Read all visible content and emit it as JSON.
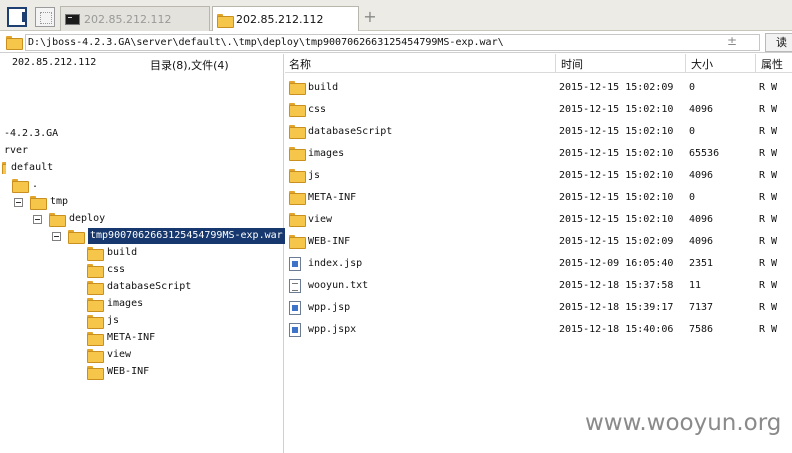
{
  "tabs": {
    "inactive_label": "202.85.212.112",
    "active_label": "202.85.212.112",
    "add_label": "+"
  },
  "pathbar": {
    "path": "D:\\jboss-4.2.3.GA\\server\\default\\.\\tmp\\deploy\\tmp9007062663125454799MS-exp.war\\",
    "spinner": "±",
    "go_label": "读"
  },
  "left": {
    "ip": "202.85.212.112",
    "counts": "目录(8),文件(4)",
    "tree": {
      "jboss": "-4.2.3.GA",
      "server": "rver",
      "default": "default",
      "dot": ".",
      "tmp": "tmp",
      "deploy": "deploy",
      "war": "tmp9007062663125454799MS-exp.war",
      "children": [
        "build",
        "css",
        "databaseScript",
        "images",
        "js",
        "META-INF",
        "view",
        "WEB-INF"
      ]
    }
  },
  "list": {
    "headers": {
      "name": "名称",
      "time": "时间",
      "size": "大小",
      "attr": "属性"
    },
    "rows": [
      {
        "type": "folder",
        "name": "build",
        "time": "2015-12-15 15:02:09",
        "size": "0",
        "attr": "R W"
      },
      {
        "type": "folder",
        "name": "css",
        "time": "2015-12-15 15:02:10",
        "size": "4096",
        "attr": "R W"
      },
      {
        "type": "folder",
        "name": "databaseScript",
        "time": "2015-12-15 15:02:10",
        "size": "0",
        "attr": "R W"
      },
      {
        "type": "folder",
        "name": "images",
        "time": "2015-12-15 15:02:10",
        "size": "65536",
        "attr": "R W"
      },
      {
        "type": "folder",
        "name": "js",
        "time": "2015-12-15 15:02:10",
        "size": "4096",
        "attr": "R W"
      },
      {
        "type": "folder",
        "name": "META-INF",
        "time": "2015-12-15 15:02:10",
        "size": "0",
        "attr": "R W"
      },
      {
        "type": "folder",
        "name": "view",
        "time": "2015-12-15 15:02:10",
        "size": "4096",
        "attr": "R W"
      },
      {
        "type": "folder",
        "name": "WEB-INF",
        "time": "2015-12-15 15:02:09",
        "size": "4096",
        "attr": "R W"
      },
      {
        "type": "jsp",
        "name": "index.jsp",
        "time": "2015-12-09 16:05:40",
        "size": "2351",
        "attr": "R W"
      },
      {
        "type": "txt",
        "name": "wooyun.txt",
        "time": "2015-12-18 15:37:58",
        "size": "11",
        "attr": "R W"
      },
      {
        "type": "jsp",
        "name": "wpp.jsp",
        "time": "2015-12-18 15:39:17",
        "size": "7137",
        "attr": "R W"
      },
      {
        "type": "jsp",
        "name": "wpp.jspx",
        "time": "2015-12-18 15:40:06",
        "size": "7586",
        "attr": "R W"
      }
    ]
  },
  "watermark": "www.wooyun.org"
}
